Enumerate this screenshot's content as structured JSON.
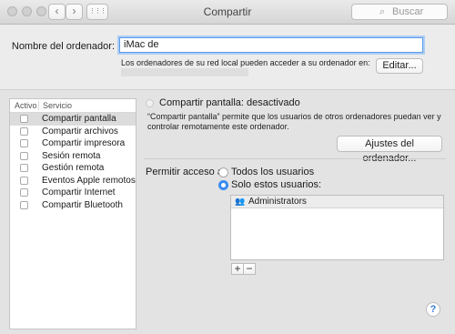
{
  "window": {
    "title": "Compartir"
  },
  "toolbar": {
    "back_icon": "‹",
    "forward_icon": "›",
    "grid_icon": "⋮⋮⋮",
    "search_placeholder": "Buscar",
    "search_icon": "⌕"
  },
  "computer": {
    "name_label": "Nombre del ordenador:",
    "name_value": "iMac de",
    "local_text": "Los ordenadores de su red local pueden acceder a su ordenador en:",
    "edit_button": "Editar..."
  },
  "services": {
    "header_active": "Activo",
    "header_service": "Servicio",
    "items": [
      {
        "label": "Compartir pantalla",
        "selected": true
      },
      {
        "label": "Compartir archivos"
      },
      {
        "label": "Compartir impresora"
      },
      {
        "label": "Sesión remota"
      },
      {
        "label": "Gestión remota"
      },
      {
        "label": "Eventos Apple remotos"
      },
      {
        "label": "Compartir Internet"
      },
      {
        "label": "Compartir Bluetooth"
      }
    ]
  },
  "detail": {
    "status": "Compartir pantalla: desactivado",
    "description": "“Compartir pantalla” permite que los usuarios de otros ordenadores puedan ver y controlar remotamente este ordenador.",
    "settings_button": "Ajustes del ordenador...",
    "access_label": "Permitir acceso a:",
    "option_all": "Todos los usuarios",
    "option_only": "Solo estos usuarios:",
    "users": [
      "Administrators"
    ],
    "add_button": "+",
    "remove_button": "−",
    "help_button": "?"
  }
}
